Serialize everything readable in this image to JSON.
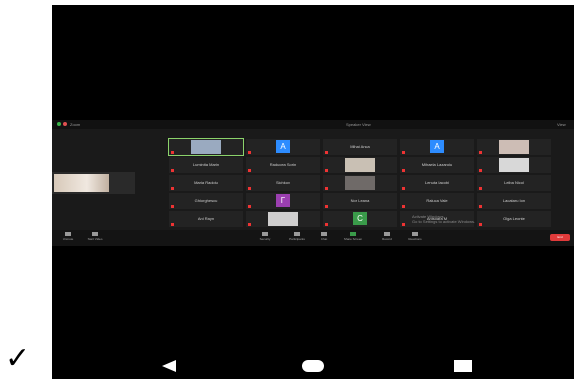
{
  "zoom_top": {
    "left_label": "Zoom",
    "center_label": "Speaker View",
    "right_label": "View"
  },
  "tiles": [
    {
      "name": "",
      "type": "photo",
      "color": "#9aaac0",
      "active": true
    },
    {
      "name": "",
      "type": "avatar",
      "letter": "A",
      "color": "#2d8cff"
    },
    {
      "name": "Mihai Anca",
      "type": "name"
    },
    {
      "name": "",
      "type": "avatar",
      "letter": "A",
      "color": "#2d8cff"
    },
    {
      "name": "",
      "type": "photo",
      "color": "#cdbdb5"
    },
    {
      "name": "Luminita Marin",
      "type": "name"
    },
    {
      "name": "Raducea Sorin",
      "type": "name"
    },
    {
      "name": "",
      "type": "photo",
      "color": "#c9c0b4"
    },
    {
      "name": "Mihaela Lazaroiu",
      "type": "name"
    },
    {
      "name": "",
      "type": "photo",
      "color": "#d8d8d8"
    },
    {
      "name": "Maria Radoiu",
      "type": "name"
    },
    {
      "name": "Sichkov",
      "type": "name"
    },
    {
      "name": "",
      "type": "photo",
      "color": "#6f6a68"
    },
    {
      "name": "Lenuta Iacobi",
      "type": "name"
    },
    {
      "name": "Leiba Nicol",
      "type": "name"
    },
    {
      "name": "Ghiorghescu",
      "type": "name"
    },
    {
      "name": "",
      "type": "avatar",
      "letter": "Γ",
      "color": "#9b3fb0"
    },
    {
      "name": "Nor Leana",
      "type": "name"
    },
    {
      "name": "Raluca Vale",
      "type": "name"
    },
    {
      "name": "Lacataru Ion",
      "type": "name"
    },
    {
      "name": "Ani Rayn",
      "type": "name"
    },
    {
      "name": "",
      "type": "photo",
      "color": "#d0cfcf"
    },
    {
      "name": "",
      "type": "avatar",
      "letter": "C",
      "color": "#3a9b4a"
    },
    {
      "name": "Anisoara M",
      "type": "name"
    },
    {
      "name": "Olga Leonte",
      "type": "name"
    }
  ],
  "bottom": {
    "left1": "Unmute",
    "left2": "Start Video",
    "b1": "Security",
    "b2": "Participants",
    "b3": "Chat",
    "b4": "Share Screen",
    "b5": "Record",
    "b6": "Reactions",
    "end": "End"
  },
  "watermark": {
    "line1": "Activate Windows",
    "line2": "Go to Settings to activate Windows."
  },
  "checkmark": "✓"
}
